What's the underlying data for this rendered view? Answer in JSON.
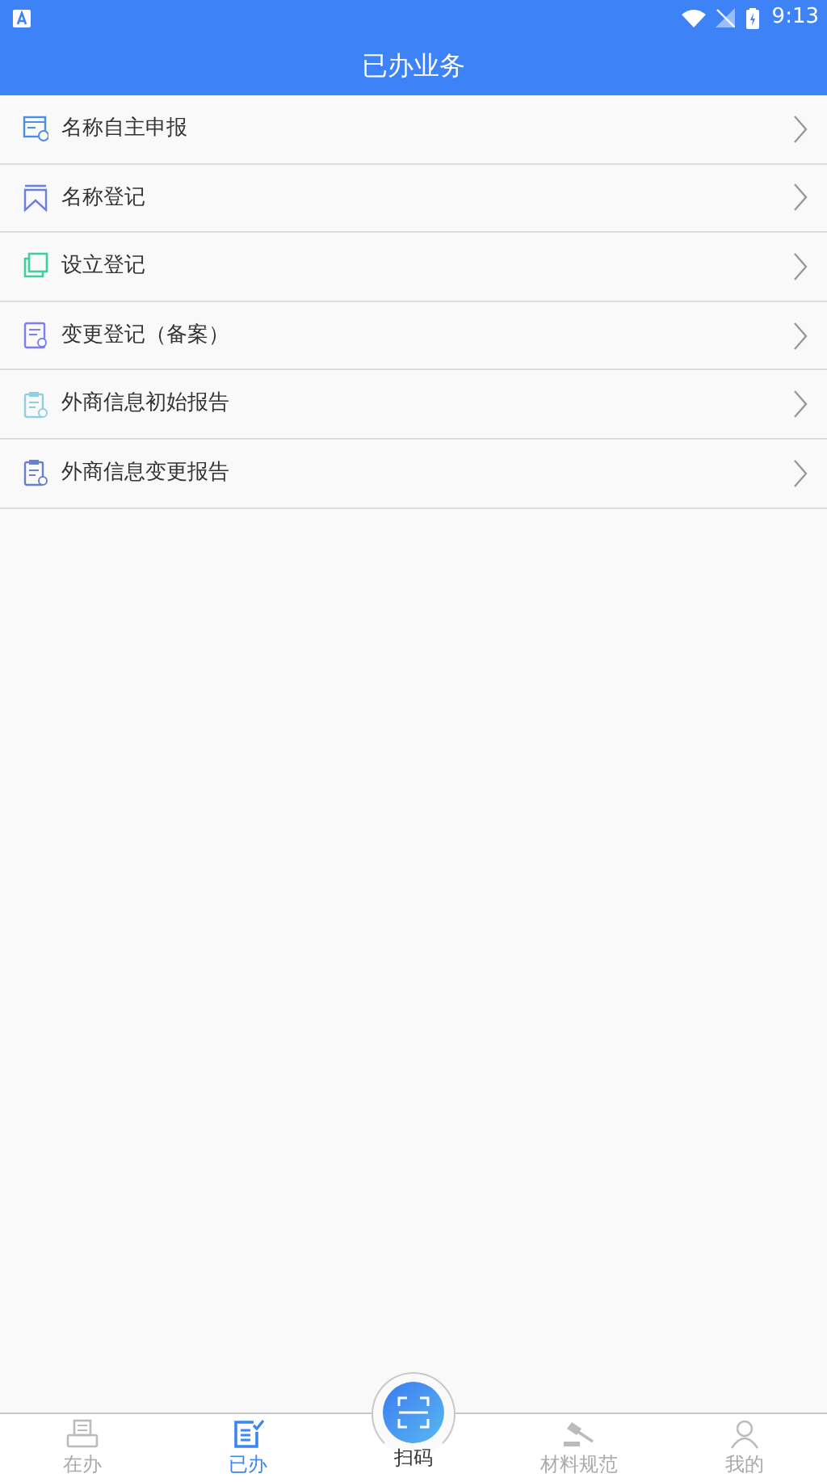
{
  "status_bar": {
    "time": "9:13"
  },
  "header": {
    "title": "已办业务"
  },
  "items": [
    {
      "label": "名称自主申报",
      "kind": "form",
      "color": "#4a90e2"
    },
    {
      "label": "名称登记",
      "kind": "bookmark",
      "color": "#6a7fe0"
    },
    {
      "label": "设立登记",
      "kind": "copy",
      "color": "#3ecfa0"
    },
    {
      "label": "变更登记（备案）",
      "kind": "doc",
      "color": "#7b7ff0"
    },
    {
      "label": "外商信息初始报告",
      "kind": "clip",
      "color": "#8fd0e0"
    },
    {
      "label": "外商信息变更报告",
      "kind": "clip",
      "color": "#6a80c8"
    }
  ],
  "tabs": [
    {
      "label": "在办",
      "kind": "printer",
      "selected": false
    },
    {
      "label": "已办",
      "kind": "done",
      "selected": true
    },
    {
      "label": "扫码",
      "kind": "scan",
      "selected": false
    },
    {
      "label": "材料规范",
      "kind": "gavel",
      "selected": false
    },
    {
      "label": "我的",
      "kind": "person",
      "selected": false
    }
  ]
}
